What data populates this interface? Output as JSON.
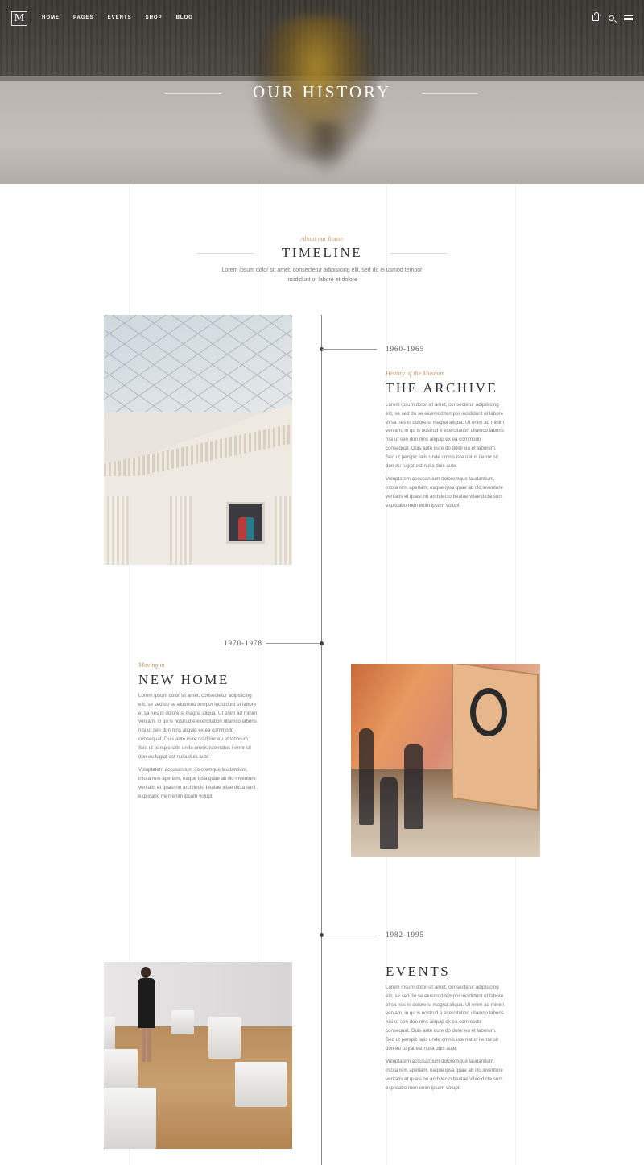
{
  "nav": {
    "logo": "M",
    "items": [
      "HOME",
      "PAGES",
      "EVENTS",
      "SHOP",
      "BLOG"
    ],
    "cart_count": "0",
    "icons": [
      "shopping-bag-icon",
      "search-icon",
      "menu-icon"
    ]
  },
  "hero": {
    "title": "OUR HISTORY"
  },
  "intro": {
    "subtitle": "About our house",
    "title": "TIMELINE",
    "text": "Lorem ipsum dolor sit amet, consectetur adipisicing elit, sed do ei usmod tempor incididunt ut labore et dolore"
  },
  "timeline": [
    {
      "years": "1960-1965",
      "subtitle": "History of the Museum",
      "title": "THE ARCHIVE",
      "p1": "Lorem ipsum dolor sit amet, consectetur adipisicing elit, se sed do se eiusmod tempor incididunt ut labore et sa nes in dolore si magna aliqua. Ut enim ad minim veniam, in qu is nostrud e exercitation ullamco laboris nisi ut sen don nins aliquip ex ea commodo consequat. Duis aute irure do dolor eu et laborum. Sed ut perspic iatis unde omnis iste natus i error sit don eu fugiat est nulla duis aute.",
      "p2": "Voluptatem accusantium doloremque laudantium, intota rem aperiam, eaque ipsa quae ab illo inventore veritatis et quasi no architecto beatae vitae dicta sunt explicabo men enim ipsam volupt"
    },
    {
      "years": "1970-1978",
      "subtitle": "Moving in",
      "title": "NEW HOME",
      "p1": "Lorem ipsum dolor sit amet, consectetur adipisicing elit, se sed do se eiusmod tempor incididunt ut labore et sa nes in dolore si magna aliqua. Ut enim ad minim veniam, in qu is nostrud e exercitation ullamco laboris nisi ut sen don nins aliquip ex ea commodo consequat. Duis aute irure do dolor eu et laborum. Sed ut perspic iatis unde omnis iste natus i error sit don eu fugiat est nulla duis aute.",
      "p2": "Voluptatem accusantium doloremque laudantium, intota rem aperiam, eaque ipsa quae ab illo inventore veritatis et quasi no architecto beatae vitae dicta sunt explicabo men enim ipsam volupt"
    },
    {
      "years": "1982-1995",
      "subtitle": "",
      "title": "EVENTS",
      "p1": "Lorem ipsum dolor sit amet, consectetur adipisicing elit, se sed do se eiusmod tempor incididunt ut labore et sa nes in dolore si magna aliqua. Ut enim ad minim veniam, in qu is nostrud e exercitation ullamco laboris nisi ut sen don nins aliquip ex ea commodo consequat. Duis aute irure do dolor eu et laborum. Sed ut perspic iatis unde omnis iste natus i error sit don eu fugiat est nulla duis aute.",
      "p2": "Voluptatem accusantium doloremque laudantium, intota rem aperiam, eaque ipsa quae ab illo inventore veritatis et quasi no architecto beatae vitae dicta sunt explicabo men enim ipsam volupt"
    }
  ],
  "colors": {
    "accent": "#c49a6c",
    "text": "#333333",
    "muted": "#777777"
  }
}
